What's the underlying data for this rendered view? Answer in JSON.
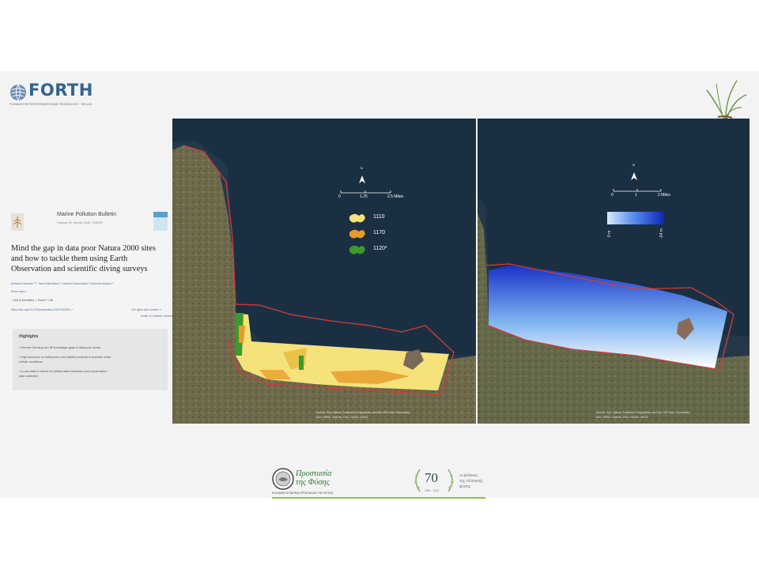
{
  "header": {
    "forth_word": "FORTH",
    "forth_subtitle": "FOUNDATION FOR RESEARCH AND TECHNOLOGY - HELLAS"
  },
  "paper": {
    "journal_name": "Marine Pollution Bulletin",
    "journal_meta": "Volume 00, Month 2025, 000000",
    "title": "Mind the gap in data poor Natura 2000 sites and how to tackle them using Earth Observation and scientific diving surveys",
    "authors": "Antonios Mazaris ᵃ ᵇ, Tarsa Nikolaidou ᵃ, Ioannis Giannoulaki ᵃ, Antonios Nastos ᵃ",
    "show_more": "Show more ⌄",
    "actions": "+ Add to Mendeley   ⩫ Share   ❝ Cite",
    "doi": "https://doi.org/10.1016/j.marpolbul.2025.000000 ↗",
    "rights": "Get rights and content ↗",
    "open_access": "Under a Creative Commons license",
    "highlights_title": "Highlights",
    "highlights": [
      "• Remote Sensing can fill knowledge gaps in data-poor areas.",
      "• High accuracy on bathymetry and habitat products is possible under",
      "   certain conditions.",
      "• In-situ data is critical for habitat data evaluation and conservation",
      "   data collection."
    ]
  },
  "map_left": {
    "north": "N",
    "scale_ticks": [
      "0",
      "1.25",
      "2.5 Miles"
    ],
    "legend": [
      {
        "label": "1110",
        "color": "#f5e27a"
      },
      {
        "label": "1170",
        "color": "#e89a2a"
      },
      {
        "label": "1120*",
        "color": "#3c9a2c"
      }
    ],
    "attribution_1": "Source: Esri, Maxar, Earthstar Geographics, and the GIS User Community",
    "attribution_2": "Esri, HERE, Garmin, FAO, NOAA, USGS"
  },
  "map_right": {
    "north": "N",
    "scale_ticks": [
      "0",
      "1",
      "2 Miles"
    ],
    "depth_min": "0 m",
    "depth_max": "-24 m",
    "attribution_1": "Source: Esri, Maxar, Earthstar Geographics, and the GIS User Community",
    "attribution_2": "Esri, HERE, Garmin, FAO, NOAA, USGS"
  },
  "footer": {
    "ptf_line1": "Προστασία",
    "ptf_line2": "της Φύσης",
    "ptf_caption": "ΕΛΛΗΝΙΚΗ ΕΤΑΙΡΕΙΑ ΠΡΟΣΤΑΣΙΑΣ ΤΗΣ ΦΥΣΗΣ",
    "anniv_number": "70",
    "anniv_line1": "οι φύλακες",
    "anniv_line2": "της ελληνικής",
    "anniv_line3": "φύσης",
    "anniv_sub": "1951 - 2021"
  },
  "colors": {
    "sea": "#1b2f42",
    "habitat_1110": "#f5e27a",
    "habitat_1170": "#e89a2a",
    "habitat_1120": "#3c9a2c",
    "boundary": "#d23c3c",
    "depth_shallow": "#ffffff",
    "depth_deep": "#1a33c8"
  }
}
